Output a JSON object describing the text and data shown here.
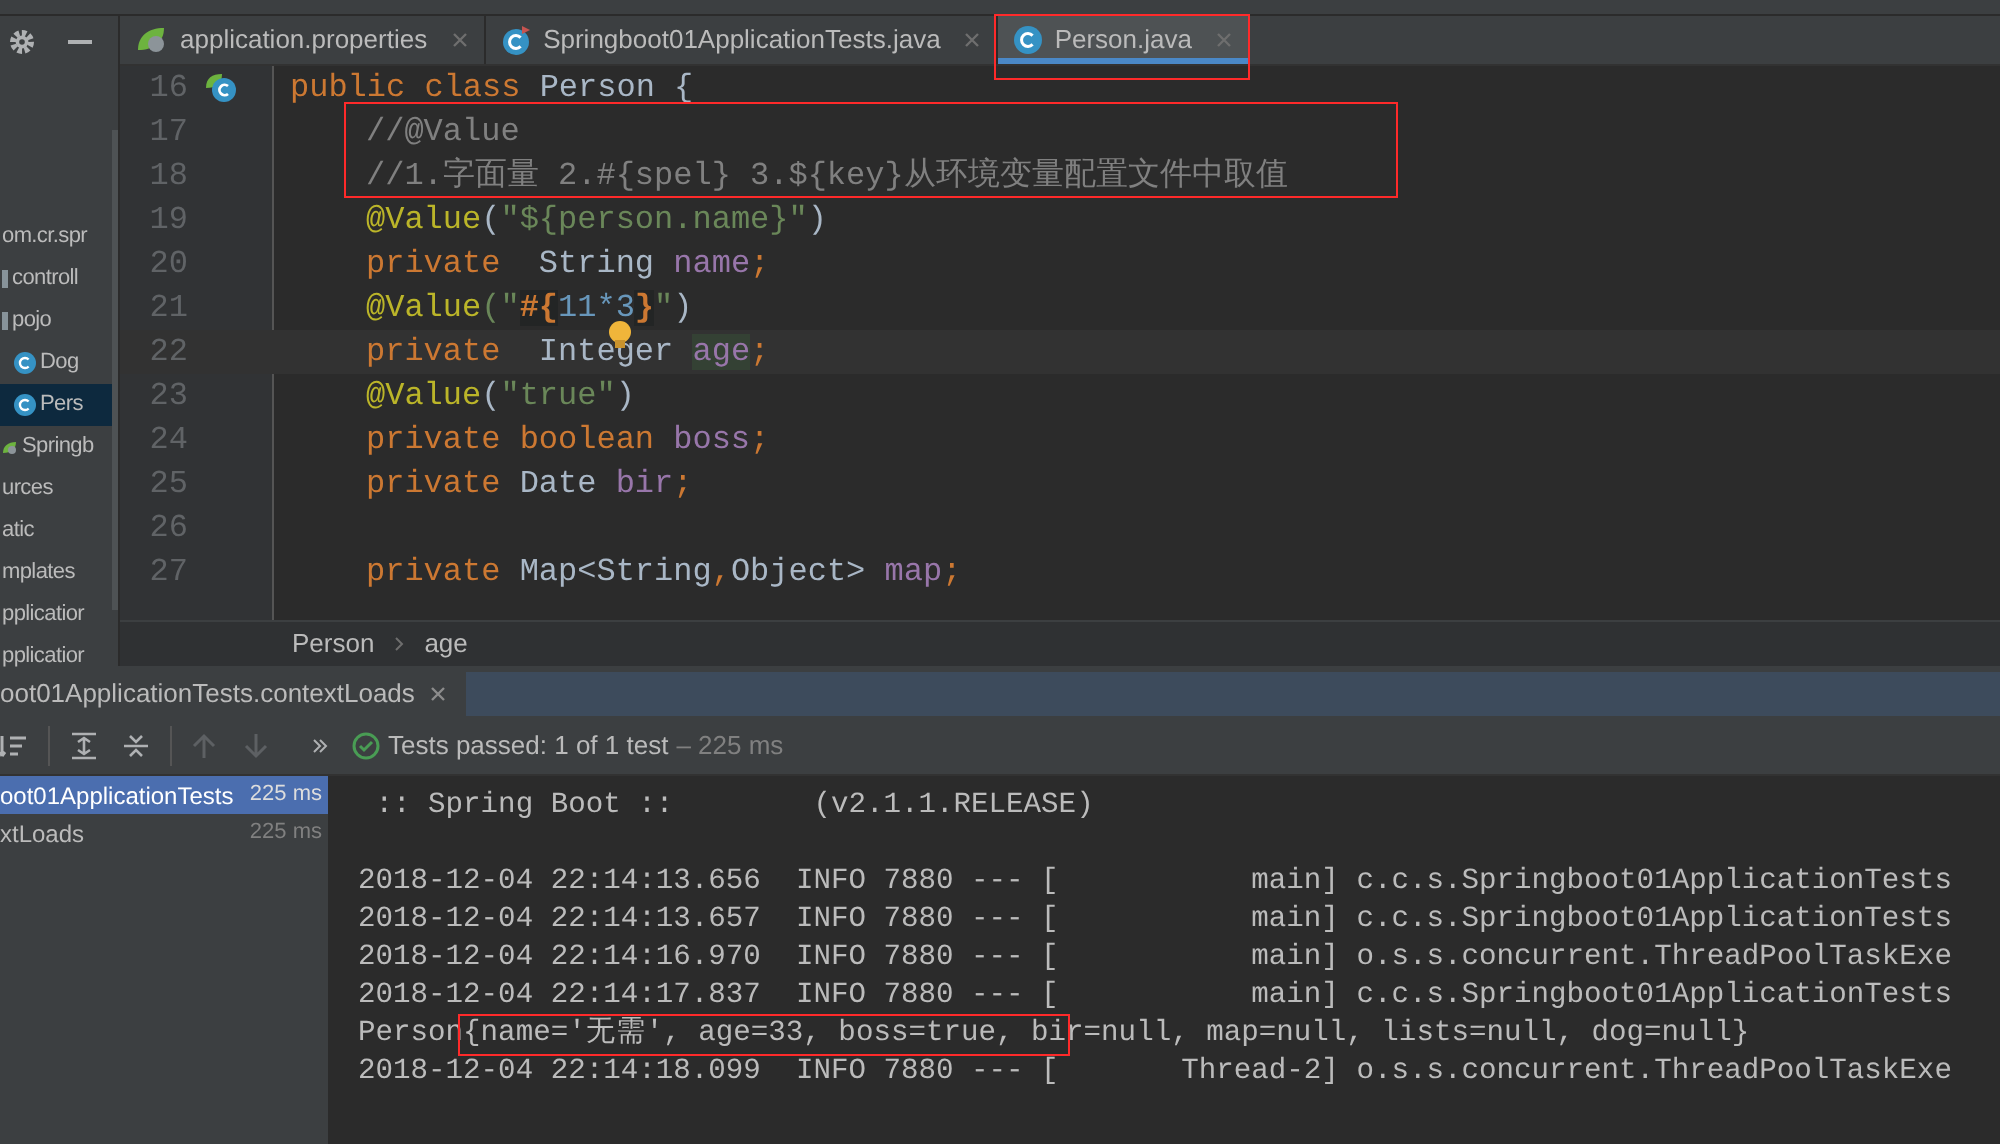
{
  "project_tree": {
    "items": [
      {
        "label": "om.cr.spr",
        "kind": "package",
        "selected": false
      },
      {
        "label": "controll",
        "kind": "folder",
        "selected": false
      },
      {
        "label": "pojo",
        "kind": "folder",
        "selected": false
      },
      {
        "label": "Dog",
        "kind": "class",
        "selected": false
      },
      {
        "label": "Pers",
        "kind": "class",
        "selected": true
      },
      {
        "label": "Springb",
        "kind": "spring",
        "selected": false
      },
      {
        "label": "urces",
        "kind": "package",
        "selected": false
      },
      {
        "label": "atic",
        "kind": "package",
        "selected": false
      },
      {
        "label": "mplates",
        "kind": "package",
        "selected": false
      },
      {
        "label": "pplicatior",
        "kind": "package",
        "selected": false
      },
      {
        "label": "pplicatior",
        "kind": "package",
        "selected": false
      }
    ]
  },
  "editor_tabs": [
    {
      "label": "application.properties",
      "kind": "spring",
      "selected": false
    },
    {
      "label": "Springboot01ApplicationTests.java",
      "kind": "test_class",
      "selected": false
    },
    {
      "label": "Person.java",
      "kind": "class",
      "selected": true,
      "boxed": true
    }
  ],
  "code_lines": [
    {
      "number": "16",
      "gutter_marker": true,
      "tokens": [
        {
          "text": "public class ",
          "kind": "keyword"
        },
        {
          "text": "Person {",
          "kind": "plain"
        }
      ]
    },
    {
      "number": "17",
      "indented": true,
      "boxed": true,
      "tokens": [
        {
          "text": "//@Value",
          "kind": "comment"
        }
      ]
    },
    {
      "number": "18",
      "indented": true,
      "boxed": true,
      "tokens": [
        {
          "text": "//1.字面量 2.#{spel} 3.${key}从环境变量配置文件中取值",
          "kind": "comment"
        }
      ]
    },
    {
      "number": "19",
      "indented": true,
      "tokens": [
        {
          "text": "@Value",
          "kind": "annotation"
        },
        {
          "text": "(",
          "kind": "plain"
        },
        {
          "text": "\"${person.name}\"",
          "kind": "string"
        },
        {
          "text": ")",
          "kind": "plain"
        }
      ]
    },
    {
      "number": "20",
      "indented": true,
      "tokens": [
        {
          "text": "private",
          "kind": "keyword"
        },
        {
          "text": "  String ",
          "kind": "plain"
        },
        {
          "text": "name",
          "kind": "field"
        },
        {
          "text": ";",
          "kind": "keyword"
        }
      ]
    },
    {
      "number": "21",
      "indented": true,
      "tokens": [
        {
          "text": "@Value",
          "kind": "annotation"
        },
        {
          "text": "(\"",
          "kind": "string"
        },
        {
          "text": "#{",
          "kind": "spel"
        },
        {
          "text": "11*3",
          "kind": "number"
        },
        {
          "text": "}",
          "kind": "spel"
        },
        {
          "text": "\"",
          "kind": "string"
        },
        {
          "text": ")",
          "kind": "plain"
        }
      ]
    },
    {
      "number": "22",
      "indented": true,
      "current": true,
      "tokens": [
        {
          "text": "private",
          "kind": "keyword"
        },
        {
          "text": "  Integer ",
          "kind": "plain"
        },
        {
          "text": "age",
          "kind": "field_highlighted"
        },
        {
          "text": ";",
          "kind": "keyword"
        }
      ]
    },
    {
      "number": "23",
      "indented": true,
      "tokens": [
        {
          "text": "@Value",
          "kind": "annotation"
        },
        {
          "text": "(",
          "kind": "plain"
        },
        {
          "text": "\"true\"",
          "kind": "string"
        },
        {
          "text": ")",
          "kind": "plain"
        }
      ]
    },
    {
      "number": "24",
      "indented": true,
      "tokens": [
        {
          "text": "private boolean ",
          "kind": "keyword"
        },
        {
          "text": "boss",
          "kind": "field"
        },
        {
          "text": ";",
          "kind": "keyword"
        }
      ]
    },
    {
      "number": "25",
      "indented": true,
      "tokens": [
        {
          "text": "private ",
          "kind": "keyword"
        },
        {
          "text": "Date ",
          "kind": "plain"
        },
        {
          "text": "bir",
          "kind": "field"
        },
        {
          "text": ";",
          "kind": "keyword"
        }
      ]
    },
    {
      "number": "26"
    },
    {
      "number": "27",
      "indented": true,
      "tokens": [
        {
          "text": "private ",
          "kind": "keyword"
        },
        {
          "text": "Map<String",
          "kind": "plain"
        },
        {
          "text": ",",
          "kind": "keyword"
        },
        {
          "text": "Object> ",
          "kind": "plain"
        },
        {
          "text": "map",
          "kind": "field"
        },
        {
          "text": ";",
          "kind": "keyword"
        }
      ]
    }
  ],
  "breadcrumb": [
    "Person",
    "age"
  ],
  "run_tab": {
    "label": "oot01ApplicationTests.contextLoads"
  },
  "test_status": {
    "text": "Tests passed: 1 of 1 test",
    "duration": "– 225 ms"
  },
  "test_tree": [
    {
      "name": "oot01ApplicationTests",
      "time": "225 ms",
      "selected": true
    },
    {
      "name": "xtLoads",
      "time": "225 ms",
      "selected": false
    }
  ],
  "console": [
    {
      "text": " :: Spring Boot ::        (v2.1.1.RELEASE)"
    },
    {
      "text": "2018-12-04 22:14:13.656  INFO 7880 --- [           main] c.c.s.Springboot01ApplicationTests",
      "blank_before": true
    },
    {
      "text": "2018-12-04 22:14:13.657  INFO 7880 --- [           main] c.c.s.Springboot01ApplicationTests"
    },
    {
      "text": "2018-12-04 22:14:16.970  INFO 7880 --- [           main] o.s.s.concurrent.ThreadPoolTaskExe"
    },
    {
      "text": "2018-12-04 22:14:17.837  INFO 7880 --- [           main] c.c.s.Springboot01ApplicationTests"
    },
    {
      "text": "Person{name='无需', age=33, boss=true, bir=null, map=null, lists=null, dog=null}",
      "boxed": true
    },
    {
      "text": "2018-12-04 22:14:18.099  INFO 7880 --- [       Thread-2] o.s.s.concurrent.ThreadPoolTaskExe"
    }
  ]
}
